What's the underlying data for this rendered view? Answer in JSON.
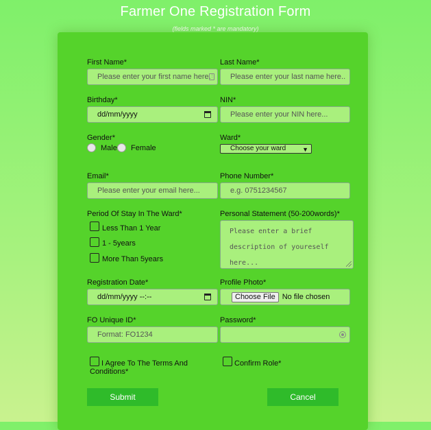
{
  "header": {
    "title": "Farmer One Registration Form",
    "subtitle": "(fields marked * are mandatory)"
  },
  "form": {
    "first_name": {
      "label": "First Name*",
      "placeholder": "Please enter your first name here."
    },
    "last_name": {
      "label": "Last Name*",
      "placeholder": "Please enter your last name here.."
    },
    "birthday": {
      "label": "Birthday*",
      "value": "dd/mm/yyyy"
    },
    "nin": {
      "label": "NIN*",
      "placeholder": "Please enter your NIN here..."
    },
    "gender": {
      "label": "Gender*",
      "options": [
        "Male",
        "Female"
      ]
    },
    "ward": {
      "label": "Ward*",
      "selected": "Choose your ward"
    },
    "email": {
      "label": "Email*",
      "placeholder": "Please enter your email here..."
    },
    "phone": {
      "label": "Phone Number*",
      "placeholder": "e.g. 0751234567"
    },
    "period": {
      "label": "Period Of Stay In The Ward*",
      "options": [
        "Less Than 1 Year",
        "1 - 5years",
        "More Than 5years"
      ]
    },
    "statement": {
      "label": "Personal Statement (50-200words)*",
      "placeholder": "Please enter a brief description of youreself here..."
    },
    "registration_date": {
      "label": "Registration Date*",
      "value": "dd/mm/yyyy --:--"
    },
    "profile_photo": {
      "label": "Profile Photo*",
      "button": "Choose File",
      "status": "No file chosen"
    },
    "fo_id": {
      "label": "FO Unique ID*",
      "placeholder": "Format: FO1234"
    },
    "password": {
      "label": "Password*",
      "placeholder": ""
    },
    "agree_terms": {
      "label_line1": "I Agree To The Terms And",
      "label_line2": "Conditions*"
    },
    "confirm_role": {
      "label": "Confirm Role*"
    },
    "submit_label": "Submit",
    "cancel_label": "Cancel"
  },
  "colors": {
    "panel": "#55d32b",
    "field": "#a9f07d",
    "button": "#2fbb2a",
    "background": "#7ff06a"
  }
}
